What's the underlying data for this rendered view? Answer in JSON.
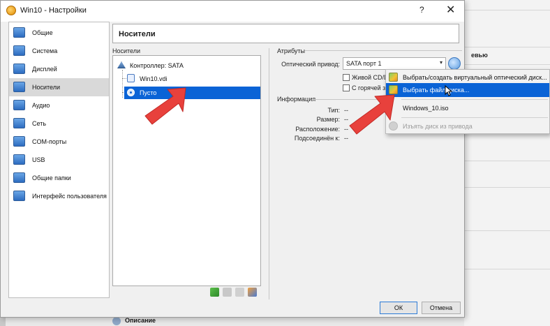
{
  "window": {
    "title": "Win10 - Настройки",
    "help_label": "?",
    "close_label": "✕"
  },
  "background": {
    "right_label": "евью",
    "bottom_label": "Описание"
  },
  "sidebar": {
    "items": [
      {
        "label": "Общие",
        "icon": "general-icon",
        "selected": false
      },
      {
        "label": "Система",
        "icon": "system-icon",
        "selected": false
      },
      {
        "label": "Дисплей",
        "icon": "display-icon",
        "selected": false
      },
      {
        "label": "Носители",
        "icon": "storage-icon",
        "selected": true
      },
      {
        "label": "Аудио",
        "icon": "audio-icon",
        "selected": false
      },
      {
        "label": "Сеть",
        "icon": "network-icon",
        "selected": false
      },
      {
        "label": "COM-порты",
        "icon": "serial-ports-icon",
        "selected": false
      },
      {
        "label": "USB",
        "icon": "usb-icon",
        "selected": false
      },
      {
        "label": "Общие папки",
        "icon": "shared-folders-icon",
        "selected": false
      },
      {
        "label": "Интерфейс пользователя",
        "icon": "user-interface-icon",
        "selected": false
      }
    ]
  },
  "page": {
    "title": "Носители"
  },
  "storage": {
    "group_label": "Носители",
    "controller": "Контроллер: SATA",
    "disk": "Win10.vdi",
    "optical": "Пусто"
  },
  "attributes": {
    "group_label": "Атрибуты",
    "optical_drive_label": "Оптический привод:",
    "optical_drive_value": "SATA порт 1",
    "live_cd_label": "Живой CD/D",
    "hotplug_label": "С горячей за"
  },
  "information": {
    "group_label": "Информация",
    "type_label": "Тип:",
    "type_value": "--",
    "size_label": "Размер:",
    "size_value": "--",
    "location_label": "Расположение:",
    "location_value": "--",
    "attached_label": "Подсоединён к:",
    "attached_value": "--"
  },
  "menu": {
    "items": [
      {
        "label": "Выбрать/создать виртуальный оптический диск...",
        "highlighted": false,
        "disabled": false
      },
      {
        "label": "Выбрать файл диска...",
        "highlighted": true,
        "disabled": false
      },
      {
        "label": "Windows_10.iso",
        "highlighted": false,
        "disabled": false
      },
      {
        "label": "Изъять диск из привода",
        "highlighted": false,
        "disabled": true
      }
    ]
  },
  "buttons": {
    "ok": "ОК",
    "cancel": "Отмена"
  },
  "colors": {
    "selection": "#0a63d6",
    "arrow": "#e8413c"
  }
}
